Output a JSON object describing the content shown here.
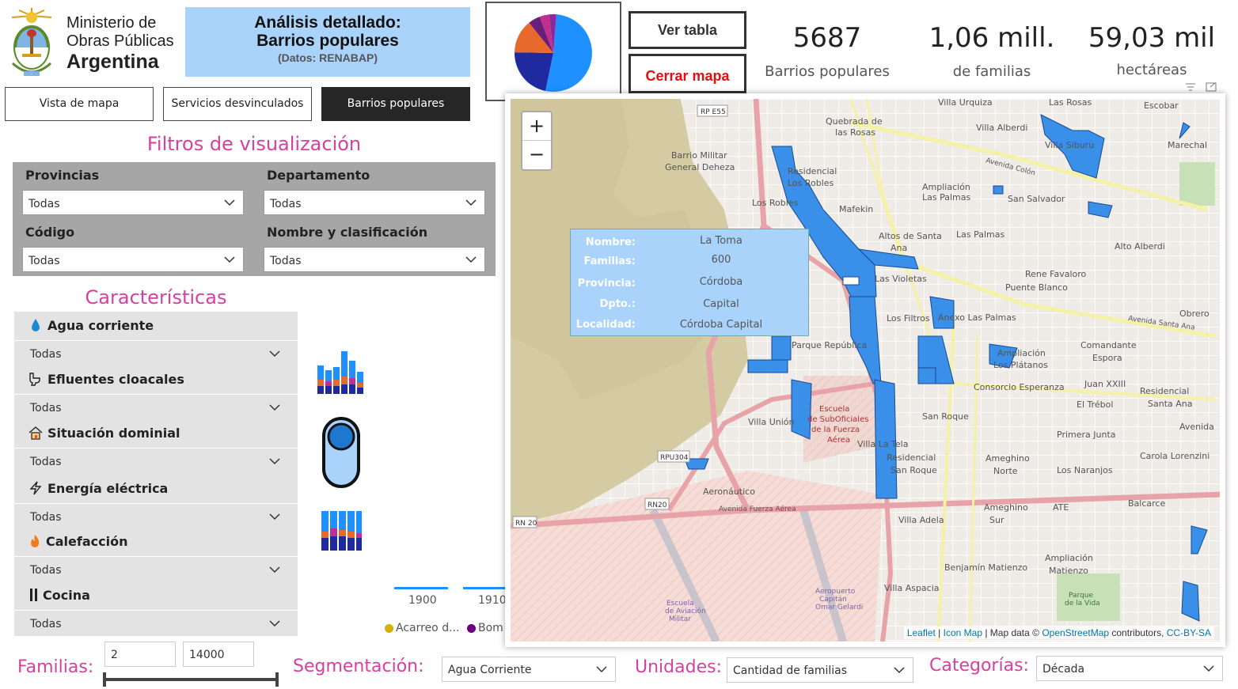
{
  "header": {
    "ministry_line1": "Ministerio de",
    "ministry_line2": "Obras Públicas",
    "ministry_line3": "Argentina",
    "title_line1": "Análisis detallado:",
    "title_line2": "Barrios populares",
    "title_sub": "(Datos: RENABAP)"
  },
  "buttons": {
    "ver_tabla": "Ver tabla",
    "cerrar_mapa": "Cerrar mapa"
  },
  "kpis": [
    {
      "value": "5687",
      "label": "Barrios populares"
    },
    {
      "value": "1,06 mill.",
      "label": "de familias"
    },
    {
      "value": "59,03 mil",
      "label": "hectáreas"
    }
  ],
  "tabs": [
    {
      "label": "Vista de mapa"
    },
    {
      "label": "Servicios desvinculados"
    },
    {
      "label": "Barrios populares"
    }
  ],
  "filters": {
    "title": "Filtros de visualización",
    "items": [
      {
        "label": "Provincias",
        "value": "Todas"
      },
      {
        "label": "Departamento",
        "value": "Todas"
      },
      {
        "label": "Código",
        "value": "Todas"
      },
      {
        "label": "Nombre y clasificación",
        "value": "Todas"
      }
    ]
  },
  "caracteristicas": {
    "title": "Características",
    "items": [
      {
        "icon": "water-drop-icon",
        "label": "Agua corriente",
        "value": "Todas"
      },
      {
        "icon": "toilet-icon",
        "label": "Efluentes cloacales",
        "value": "Todas"
      },
      {
        "icon": "house-icon",
        "label": "Situación dominial",
        "value": "Todas"
      },
      {
        "icon": "lightning-icon",
        "label": "Energía eléctrica",
        "value": "Todas"
      },
      {
        "icon": "fire-icon",
        "label": "Calefacción",
        "value": "Todas"
      },
      {
        "icon": "utensils-icon",
        "label": "Cocina",
        "value": "Todas"
      }
    ]
  },
  "timeline": {
    "ticks": [
      "1900",
      "1910"
    ],
    "legend": [
      {
        "label": "Acarreo d...",
        "color": "#d4b000"
      },
      {
        "label": "Bom",
        "color": "#6a0080"
      }
    ]
  },
  "bottom": {
    "familias_label": "Familias:",
    "familias_min": "2",
    "familias_max": "14000",
    "segmentacion_label": "Segmentación:",
    "segmentacion_value": "Agua Corriente",
    "unidades_label": "Unidades:",
    "unidades_value": "Cantidad de familias",
    "categorias_label": "Categorías:",
    "categorias_value": "Década"
  },
  "map": {
    "zoom_in": "+",
    "zoom_out": "−",
    "attribution_leaflet": "Leaflet",
    "attribution_sep1": " | ",
    "attribution_iconmap": "Icon Map",
    "attribution_mid": " | Map data © ",
    "attribution_osm": "OpenStreetMap",
    "attribution_contrib": " contributors, ",
    "attribution_license": "CC-BY-SA",
    "place_labels": [
      "Villa Urquiza",
      "Las Rosas",
      "Escobar",
      "Quebrada de las Rosas",
      "Villa Alberdi",
      "Marechal",
      "Villa Siburu",
      "Barrio Militar General Deheza",
      "Residencial Los Robles",
      "Ampliación Las Palmas",
      "San Salvador",
      "Los Robles",
      "Mafekin",
      "Altos de Santa Ana",
      "Las Palmas",
      "Alto Alberdi",
      "Rene Favaloro",
      "Puente Blanco",
      "Las Violetas",
      "Los Filtros",
      "Anexo Las Palmas",
      "Obrero",
      "Parque República",
      "Comandante Espora",
      "Ampliación Los Plátanos",
      "Consorcio Esperanza",
      "Juan XXIII",
      "Residencial Santa Ana",
      "El Trébol",
      "San Roque",
      "Villa Unión",
      "Primera Junta",
      "Villa La Tela",
      "Avenida",
      "Carola Lorenzini",
      "Residencial San Roque",
      "Ameghino Norte",
      "Los Naranjos",
      "Aeronáutico",
      "Balcarce",
      "Villa Adela",
      "Ameghino Sur",
      "ATE",
      "Benjamín Matienzo",
      "Ampliación Matienzo",
      "Villa Aspacia",
      "Escuela de SubOficiales de la Fuerza Aérea",
      "Escuela de Aviación Militar",
      "Aeropuerto Capitán Omar Gelardi",
      "Parque de la Vida",
      "Avenida Fuerza Aérea",
      "Avenida Colón",
      "Avenida Santa Ana",
      "RP E55",
      "RPU304",
      "RN20",
      "RN 20"
    ],
    "tooltip": [
      {
        "key": "Nombre:",
        "value": "La Toma"
      },
      {
        "key": "Familias:",
        "value": "600"
      },
      {
        "key": "Provincia:",
        "value": "Córdoba"
      },
      {
        "key": "Dpto.:",
        "value": "Capital"
      },
      {
        "key": "Localidad:",
        "value": "Córdoba Capital"
      }
    ]
  },
  "pie_chart": {
    "slices": [
      {
        "value": 0.52,
        "color": "#1e90ff"
      },
      {
        "value": 0.22,
        "color": "#1f2aa0"
      },
      {
        "value": 0.14,
        "color": "#e8692c"
      },
      {
        "value": 0.05,
        "color": "#6b1e78"
      },
      {
        "value": 0.04,
        "color": "#c2308f"
      },
      {
        "value": 0.03,
        "color": "#8a2a9c"
      }
    ]
  },
  "colors": {
    "accent_pink": "#d6409f",
    "title_blue": "#a9d3fb",
    "barrio_blue": "#3a8fe8",
    "red_button": "#e01010"
  }
}
